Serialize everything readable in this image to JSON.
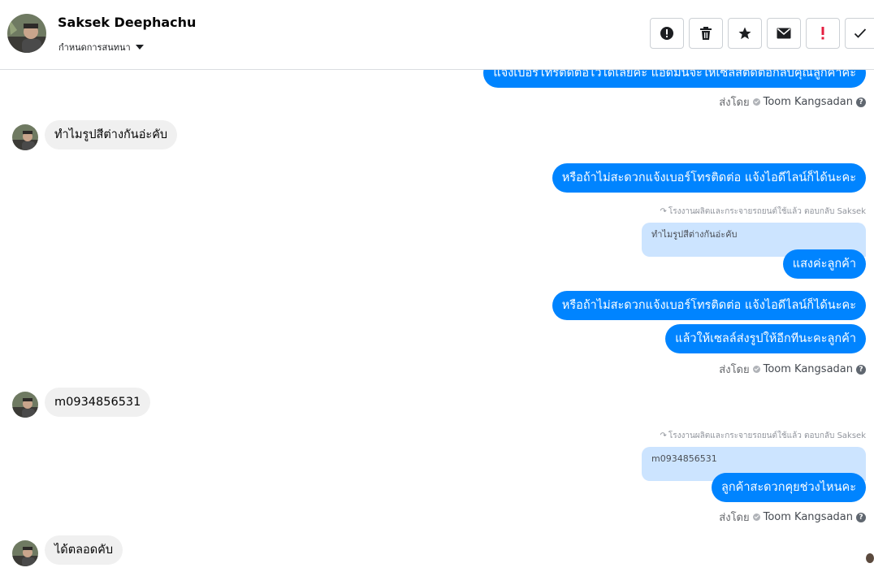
{
  "header": {
    "contact_name": "Saksek Deephachu",
    "label_select": "กำหนดการสนทนา",
    "toolbar": [
      {
        "name": "spam-button",
        "icon": "exclamation-circle-icon"
      },
      {
        "name": "delete-button",
        "icon": "trash-icon"
      },
      {
        "name": "star-button",
        "icon": "star-icon"
      },
      {
        "name": "mark-unread-button",
        "icon": "envelope-icon"
      },
      {
        "name": "important-button",
        "icon": "exclamation-icon"
      },
      {
        "name": "done-button",
        "icon": "check-icon"
      }
    ]
  },
  "messages": {
    "m1_out": "แจ้งเบอร์โทรติดต่อไว้ได้เลยค่ะ แอดมินจะให้เซลส์ติดต่อกลับคุณลูกค้าค่ะ",
    "sent_by_1": {
      "label": "ส่งโดย",
      "name": "Toom Kangsadan"
    },
    "m2_in": "ทำไมรูปสีต่างกันอ่ะคับ",
    "m3_out": "หรือถ้าไม่สะดวกแจ้งเบอร์โทรติดต่อ แจ้งไอดีไลน์ก็ได้นะคะ",
    "reply_note_1": "โรงงานผลิตและกระจายรถยนต์ใช้แล้ว ตอบกลับ Saksek",
    "quote_1": "ทำไมรูปสีต่างกันอ่ะคับ",
    "m4_out": "แสงค่ะลูกค้า",
    "m5_out": "หรือถ้าไม่สะดวกแจ้งเบอร์โทรติดต่อ แจ้งไอดีไลน์ก็ได้นะคะ",
    "m6_out": "แล้วให้เซลล์ส่งรูปให้อีกทีนะคะลูกค้า",
    "sent_by_2": {
      "label": "ส่งโดย",
      "name": "Toom Kangsadan"
    },
    "m7_in": "m0934856531",
    "reply_note_2": "โรงงานผลิตและกระจายรถยนต์ใช้แล้ว ตอบกลับ Saksek",
    "quote_2": "m0934856531",
    "m8_out": "ลูกค้าสะดวกคุยช่วงไหนคะ",
    "sent_by_3": {
      "label": "ส่งโดย",
      "name": "Toom Kangsadan"
    },
    "m9_in": "ได้ตลอดคับ"
  },
  "colors": {
    "outgoing_bubble": "#0084ff",
    "incoming_bubble": "#f0f0f0",
    "quote_bg": "#cce4ff",
    "important_red": "#e41e3f"
  }
}
